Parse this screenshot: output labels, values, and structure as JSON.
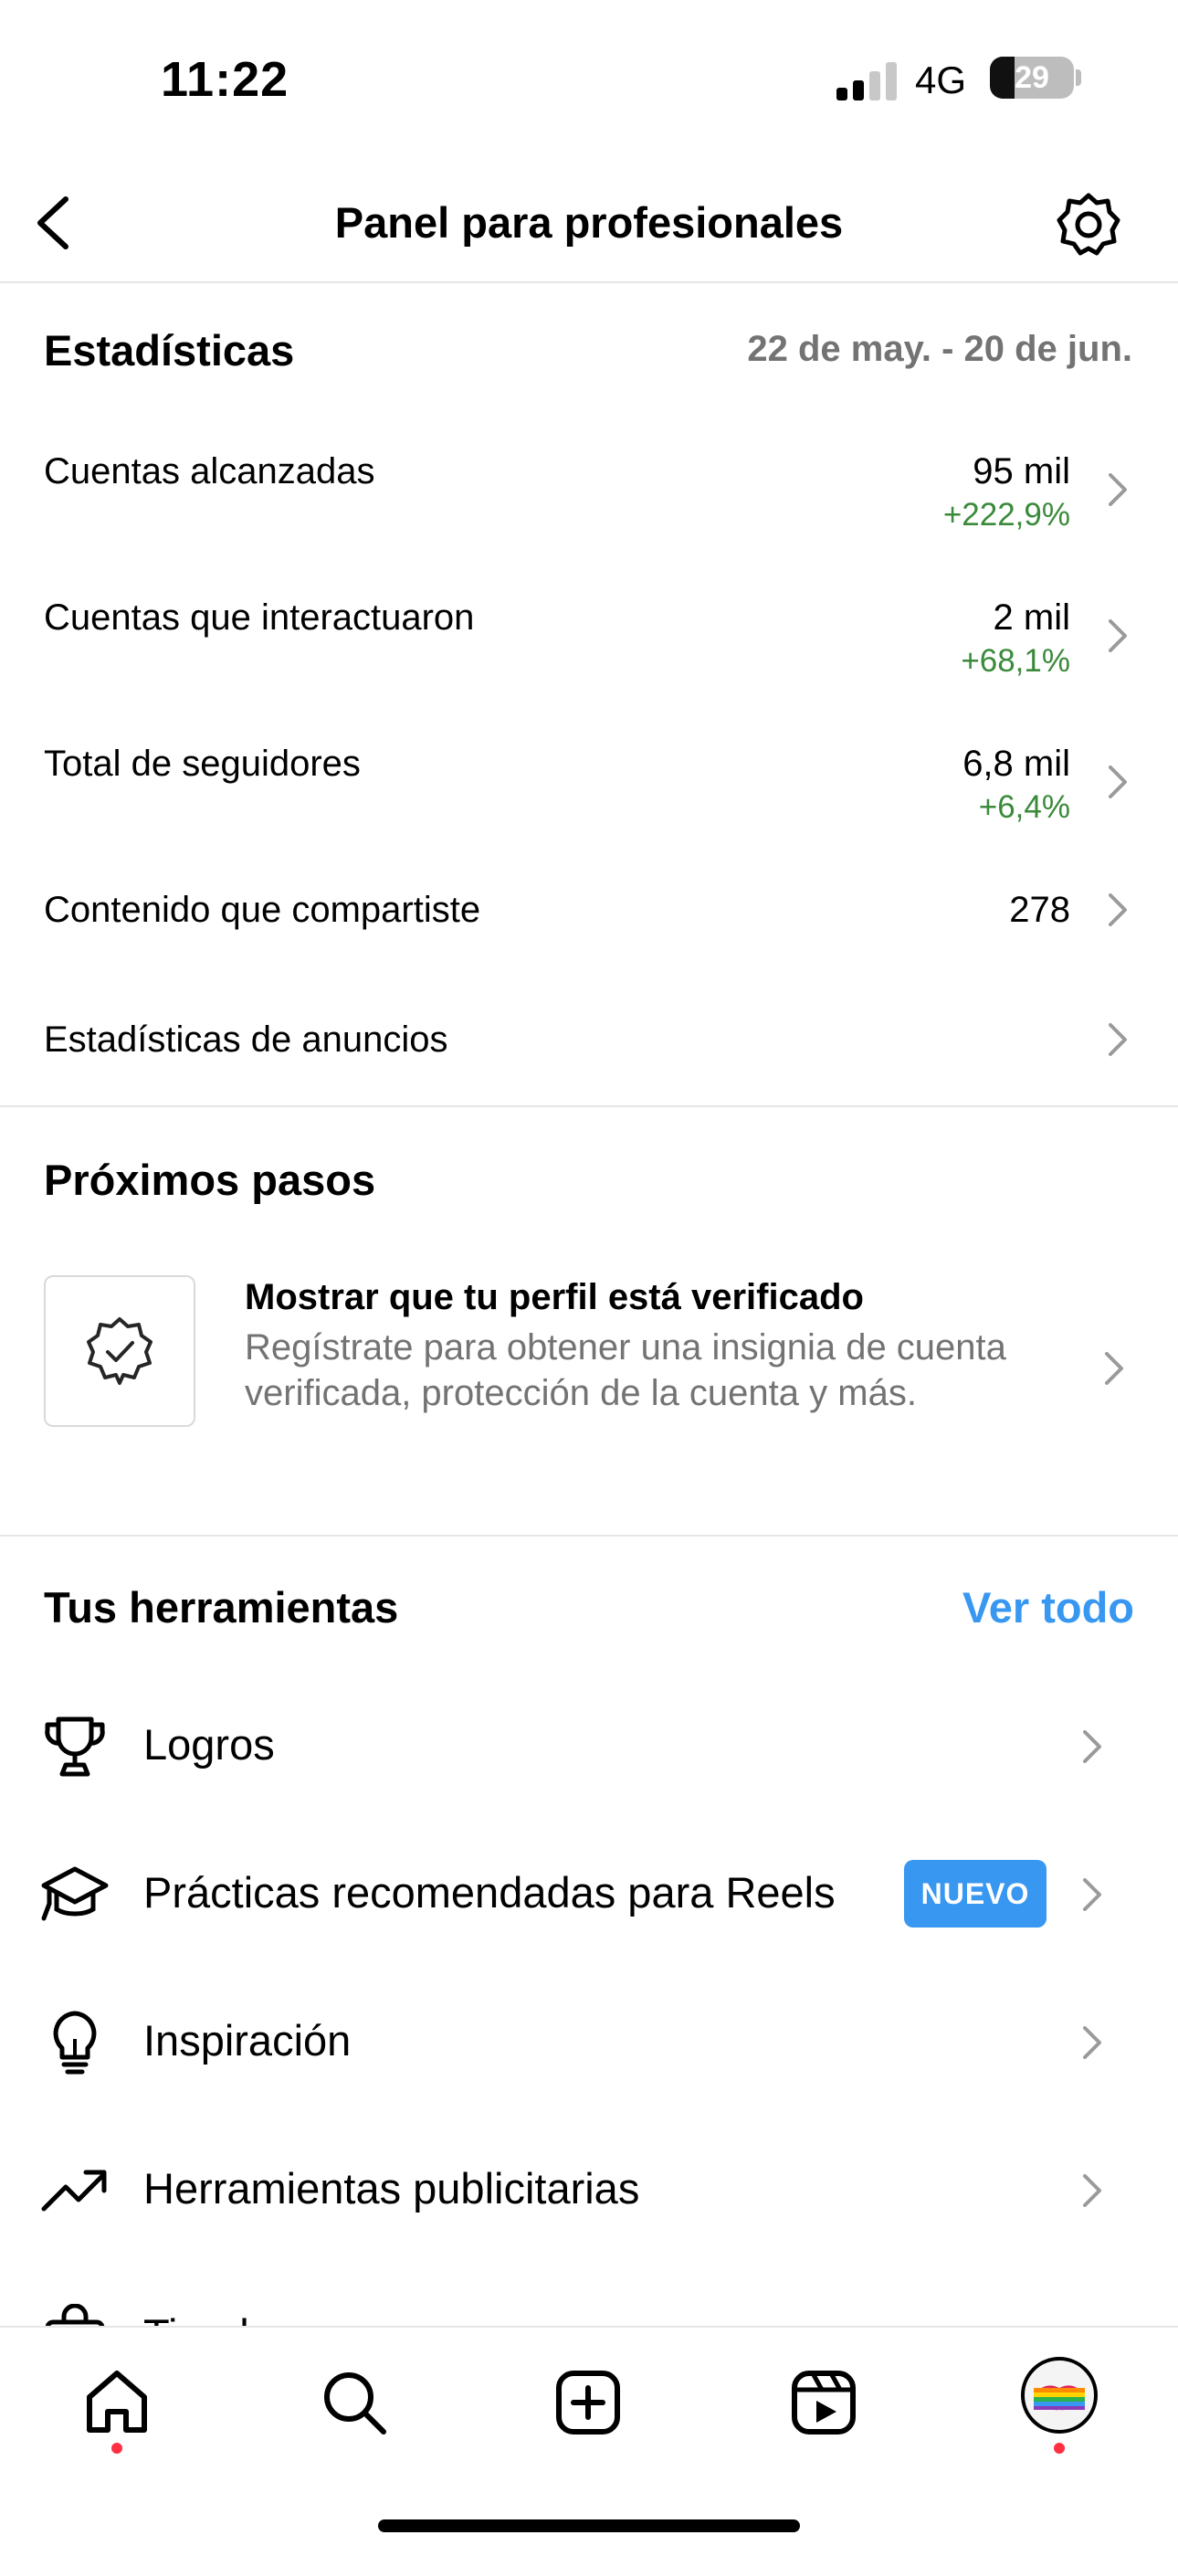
{
  "status_bar": {
    "time": "11:22",
    "network": "4G",
    "battery_level": "29"
  },
  "header": {
    "title": "Panel para profesionales",
    "back_icon": "chevron-left-icon",
    "settings_icon": "gear-icon"
  },
  "insights": {
    "title": "Estadísticas",
    "date_range": "22 de may. - 20 de jun.",
    "rows": [
      {
        "label": "Cuentas alcanzadas",
        "value": "95 mil",
        "delta": "+222,9%"
      },
      {
        "label": "Cuentas que interactuaron",
        "value": "2 mil",
        "delta": "+68,1%"
      },
      {
        "label": "Total de seguidores",
        "value": "6,8 mil",
        "delta": "+6,4%"
      },
      {
        "label": "Contenido que compartiste",
        "value": "278",
        "delta": ""
      },
      {
        "label": "Estadísticas de anuncios",
        "value": "",
        "delta": ""
      }
    ]
  },
  "next_steps": {
    "title": "Próximos pasos",
    "card": {
      "title": "Mostrar que tu perfil está verificado",
      "description": "Regístrate para obtener una insignia de cuenta verificada, protección de la cuenta y más.",
      "icon": "verified-badge-icon"
    }
  },
  "tools": {
    "title": "Tus herramientas",
    "see_all": "Ver todo",
    "items": [
      {
        "label": "Logros",
        "icon": "trophy-icon",
        "badge": ""
      },
      {
        "label": "Prácticas recomendadas para Reels",
        "icon": "graduation-cap-icon",
        "badge": "NUEVO"
      },
      {
        "label": "Inspiración",
        "icon": "lightbulb-icon",
        "badge": ""
      },
      {
        "label": "Herramientas publicitarias",
        "icon": "trending-up-icon",
        "badge": ""
      },
      {
        "label": "Tienda",
        "icon": "shopping-bag-icon",
        "badge": ""
      }
    ]
  },
  "tab_bar": {
    "items": [
      "home-icon",
      "search-icon",
      "create-icon",
      "reels-icon",
      "profile-avatar"
    ]
  },
  "colors": {
    "accent": "#3897f0",
    "positive": "#3a8a3a",
    "secondary_text": "#737373",
    "notification": "#ff3040"
  }
}
